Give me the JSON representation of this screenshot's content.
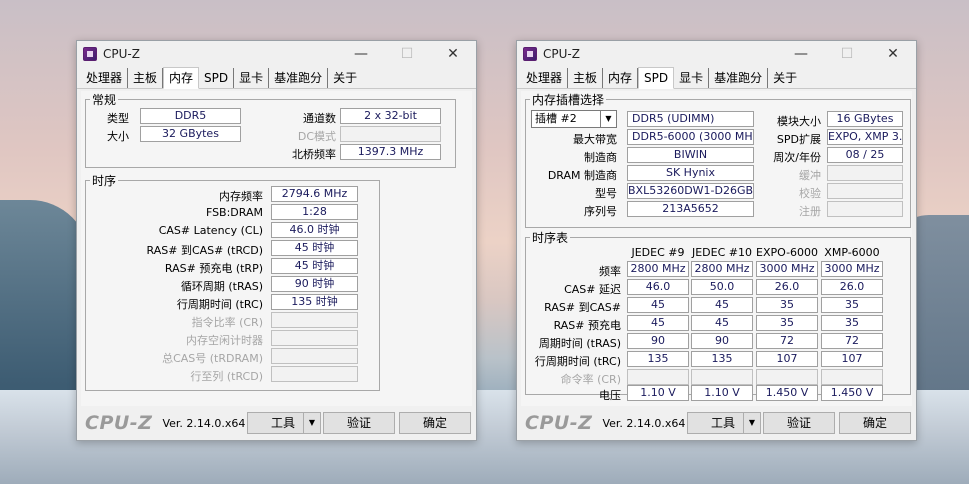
{
  "windows": [
    {
      "title": "CPU-Z",
      "controls": {
        "minimize": "—",
        "maximize": "☐",
        "close": "✕"
      },
      "tabs": [
        "处理器",
        "主板",
        "内存",
        "SPD",
        "显卡",
        "基准跑分",
        "关于"
      ],
      "active_tab": "内存",
      "general": {
        "legend": "常规",
        "type_label": "类型",
        "type_value": "DDR5",
        "size_label": "大小",
        "size_value": "32 GBytes",
        "channels_label": "通道数",
        "channels_value": "2 x 32-bit",
        "dc_label": "DC模式",
        "dc_value": "",
        "nb_label": "北桥频率",
        "nb_value": "1397.3 MHz"
      },
      "timings": {
        "legend": "时序",
        "rows": [
          {
            "label": "内存频率",
            "value": "2794.6 MHz",
            "disabled": false
          },
          {
            "label": "FSB:DRAM",
            "value": "1:28",
            "disabled": false
          },
          {
            "label": "CAS# Latency (CL)",
            "value": "46.0 时钟",
            "disabled": false
          },
          {
            "label": "RAS# 到CAS# (tRCD)",
            "value": "45 时钟",
            "disabled": false
          },
          {
            "label": "RAS# 预充电 (tRP)",
            "value": "45 时钟",
            "disabled": false
          },
          {
            "label": "循环周期 (tRAS)",
            "value": "90 时钟",
            "disabled": false
          },
          {
            "label": "行周期时间 (tRC)",
            "value": "135 时钟",
            "disabled": false
          },
          {
            "label": "指令比率 (CR)",
            "value": "",
            "disabled": true
          },
          {
            "label": "内存空闲计时器",
            "value": "",
            "disabled": true
          },
          {
            "label": "总CAS号 (tRDRAM)",
            "value": "",
            "disabled": true
          },
          {
            "label": "行至列 (tRCD)",
            "value": "",
            "disabled": true
          }
        ]
      },
      "footer": {
        "logo": "CPU-Z",
        "version": "Ver. 2.14.0.x64",
        "tools": "工具",
        "verify": "验证",
        "ok": "确定"
      }
    },
    {
      "title": "CPU-Z",
      "controls": {
        "minimize": "—",
        "maximize": "☐",
        "close": "✕"
      },
      "tabs": [
        "处理器",
        "主板",
        "内存",
        "SPD",
        "显卡",
        "基准跑分",
        "关于"
      ],
      "active_tab": "SPD",
      "slot": {
        "legend": "内存插槽选择",
        "slot_select": "插槽 #2",
        "module_type": "DDR5 (UDIMM)",
        "module_size_label": "模块大小",
        "module_size": "16 GBytes",
        "max_bw_label": "最大带宽",
        "max_bw": "DDR5-6000 (3000 MHz)",
        "spd_ext_label": "SPD扩展",
        "spd_ext": "EXPO, XMP 3.0",
        "manuf_label": "制造商",
        "manuf": "BIWIN",
        "week_label": "周次/年份",
        "week": "08 / 25",
        "dram_manuf_label": "DRAM 制造商",
        "dram_manuf": "SK Hynix",
        "buffer_label": "缓冲",
        "buffer": "",
        "part_label": "型号",
        "part": "BXL53260DW1-D26GB",
        "check_label": "校验",
        "check": "",
        "serial_label": "序列号",
        "serial": "213A5652",
        "reg_label": "注册",
        "reg": ""
      },
      "timing_table": {
        "legend": "时序表",
        "columns": [
          "JEDEC #9",
          "JEDEC #10",
          "EXPO-6000",
          "XMP-6000"
        ],
        "rows": [
          {
            "label": "频率",
            "values": [
              "2800 MHz",
              "2800 MHz",
              "3000 MHz",
              "3000 MHz"
            ],
            "disabled": false
          },
          {
            "label": "CAS# 延迟",
            "values": [
              "46.0",
              "50.0",
              "26.0",
              "26.0"
            ],
            "disabled": false
          },
          {
            "label": "RAS# 到CAS#",
            "values": [
              "45",
              "45",
              "35",
              "35"
            ],
            "disabled": false
          },
          {
            "label": "RAS# 预充电",
            "values": [
              "45",
              "45",
              "35",
              "35"
            ],
            "disabled": false
          },
          {
            "label": "周期时间 (tRAS)",
            "values": [
              "90",
              "90",
              "72",
              "72"
            ],
            "disabled": false
          },
          {
            "label": "行周期时间 (tRC)",
            "values": [
              "135",
              "135",
              "107",
              "107"
            ],
            "disabled": false
          },
          {
            "label": "命令率 (CR)",
            "values": [
              "",
              "",
              "",
              ""
            ],
            "disabled": true
          },
          {
            "label": "电压",
            "values": [
              "1.10 V",
              "1.10 V",
              "1.450 V",
              "1.450 V"
            ],
            "disabled": false
          }
        ]
      },
      "footer": {
        "logo": "CPU-Z",
        "version": "Ver. 2.14.0.x64",
        "tools": "工具",
        "verify": "验证",
        "ok": "确定"
      }
    }
  ]
}
